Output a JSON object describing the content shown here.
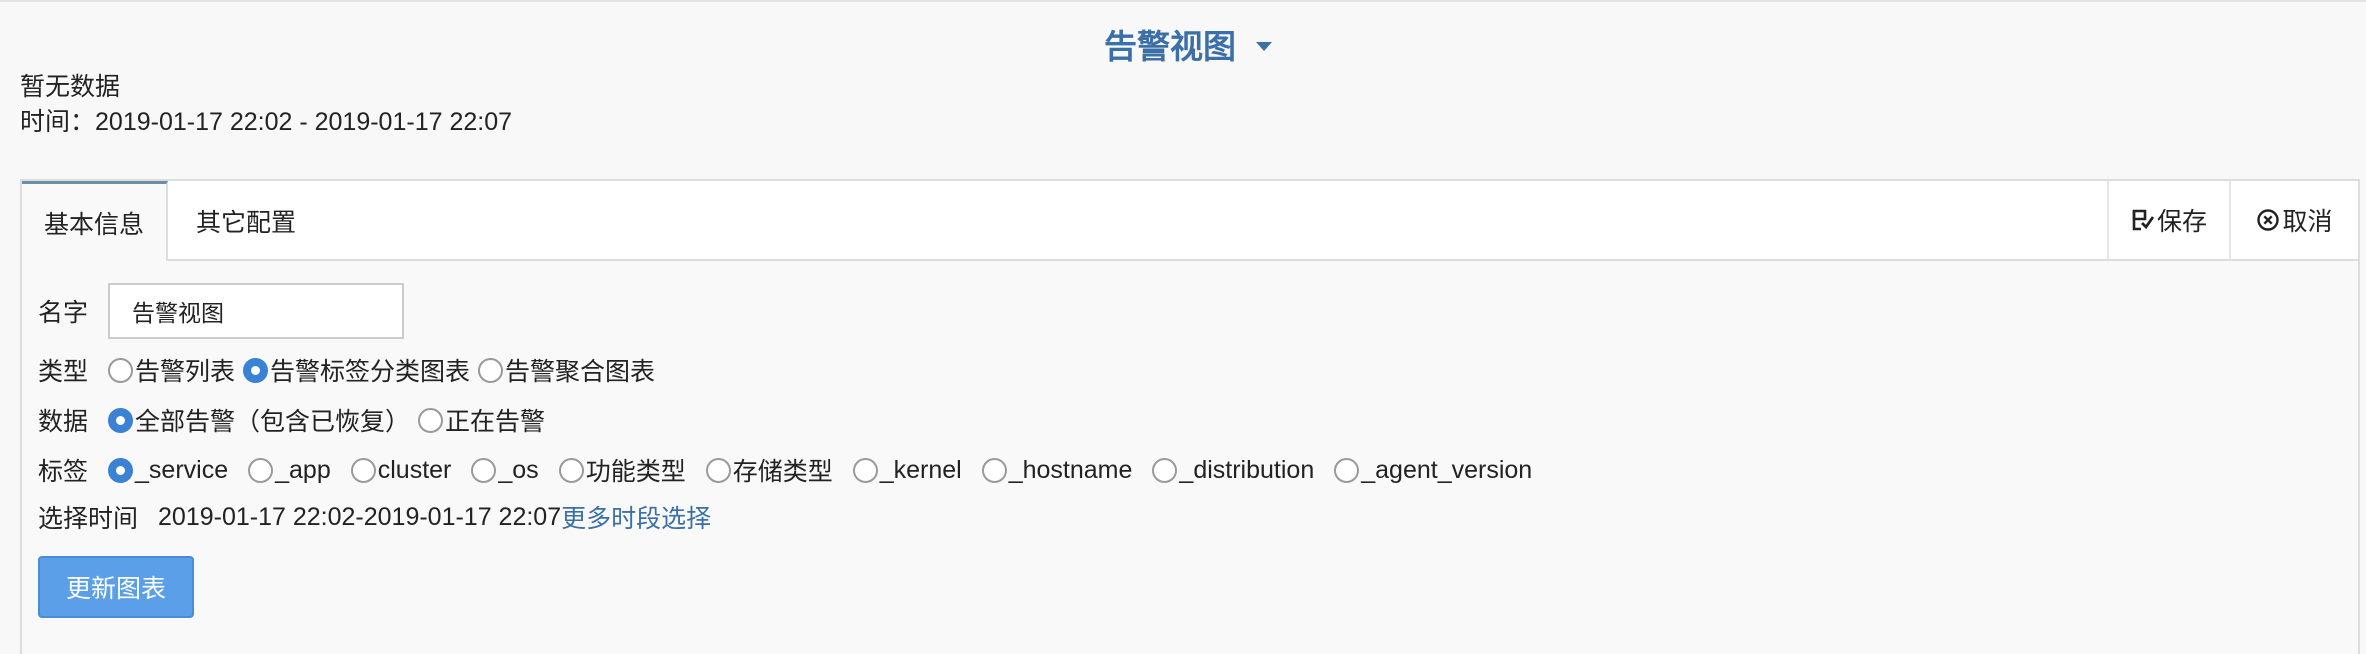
{
  "header": {
    "view_title": "告警视图",
    "no_data_text": "暂无数据",
    "time_label": "时间：",
    "time_range": "2019-01-17 22:02 - 2019-01-17 22:07"
  },
  "tabs": [
    {
      "label": "基本信息",
      "active": true
    },
    {
      "label": "其它配置",
      "active": false
    }
  ],
  "actions": {
    "save_label": "保存",
    "cancel_label": "取消"
  },
  "form": {
    "name_label": "名字",
    "name_value": "告警视图",
    "type_label": "类型",
    "type_options": [
      {
        "label": "告警列表",
        "checked": false
      },
      {
        "label": "告警标签分类图表",
        "checked": true
      },
      {
        "label": "告警聚合图表",
        "checked": false
      }
    ],
    "data_label": "数据",
    "data_options": [
      {
        "label": "全部告警（包含已恢复）",
        "checked": true
      },
      {
        "label": "正在告警",
        "checked": false
      }
    ],
    "tag_label": "标签",
    "tag_options": [
      {
        "label": "_service",
        "checked": true
      },
      {
        "label": "_app",
        "checked": false
      },
      {
        "label": "cluster",
        "checked": false
      },
      {
        "label": "_os",
        "checked": false
      },
      {
        "label": "功能类型",
        "checked": false
      },
      {
        "label": "存储类型",
        "checked": false
      },
      {
        "label": "_kernel",
        "checked": false
      },
      {
        "label": "_hostname",
        "checked": false
      },
      {
        "label": "_distribution",
        "checked": false
      },
      {
        "label": "_agent_version",
        "checked": false
      }
    ],
    "select_time_label": "选择时间",
    "select_time_value": "2019-01-17 22:02-2019-01-17 22:07",
    "more_time_link": "更多时段选择",
    "update_button": "更新图表"
  },
  "colors": {
    "accent": "#3a6fa8",
    "radio_checked": "#3b82d4",
    "primary_button": "#5a9fe8"
  },
  "icons": {
    "dropdown": "caret-down-icon",
    "save": "save-icon",
    "cancel": "close-circle-icon",
    "radio": "radio-icon"
  }
}
